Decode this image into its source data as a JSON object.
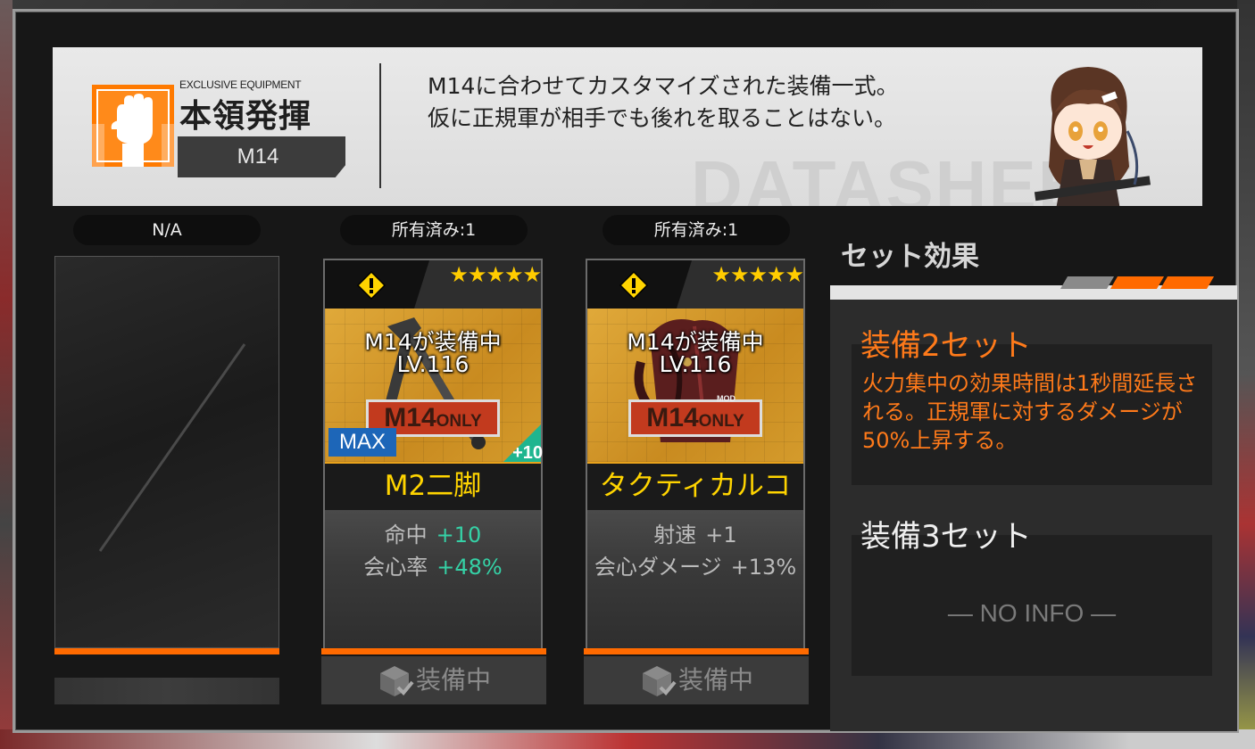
{
  "banner": {
    "sub_title": "EXCLUSIVE EQUIPMENT",
    "main_title": "本領発揮",
    "doll_name": "M14",
    "description_line1": "M14に合わせてカスタマイズされた装備一式。",
    "description_line2": "仮に正規軍が相手でも後れを取ることはない。",
    "watermark": "DATASHEET"
  },
  "slots": [
    {
      "tag": "N/A"
    },
    {
      "tag": "所有済み:1",
      "stars": "★★★★★",
      "equipped_by": "M14が装備中",
      "level": "LV.116",
      "only_badge_model": "M14",
      "only_badge_suffix": "ONLY",
      "max_label": "MAX",
      "enhance_label": "+10",
      "name": "M2二脚",
      "stats": [
        {
          "label": "命中",
          "value": "+10"
        },
        {
          "label": "会心率",
          "value": "+48%"
        }
      ],
      "button_label": "装備中"
    },
    {
      "tag": "所有済み:1",
      "stars": "★★★★★",
      "equipped_by": "M14が装備中",
      "level": "LV.116",
      "only_badge_model": "M14",
      "only_badge_suffix": "ONLY",
      "mod_label": "MOD",
      "name": "タクティカルコート",
      "stats": [
        {
          "label": "射速",
          "value": "+1"
        },
        {
          "label": "会心ダメージ",
          "value": "+13%"
        }
      ],
      "button_label": "装備中"
    }
  ],
  "set_effect": {
    "title": "セット効果",
    "set2_heading": "装備2セット",
    "set2_description": "火力集中の効果時間は1秒間延長される。正規軍に対するダメージが50%上昇する。",
    "set3_heading": "装備3セット",
    "set3_placeholder": "— NO INFO —"
  },
  "colors": {
    "accent_orange": "#ff6a00",
    "star_gold": "#ffcc00",
    "name_yellow": "#ffd400",
    "stat_teal": "#35d1a6",
    "max_blue": "#1d66b8"
  }
}
